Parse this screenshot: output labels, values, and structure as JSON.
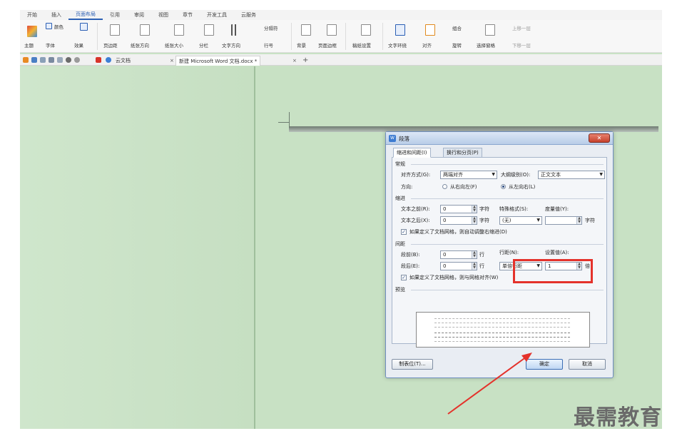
{
  "menu": {
    "tabs": [
      "开始",
      "插入",
      "页面布局",
      "引用",
      "审阅",
      "视图",
      "章节",
      "开发工具",
      "云服务"
    ],
    "active_tab": "页面布局"
  },
  "ribbon": {
    "theme": "主题",
    "color": "颜色",
    "font": "字体",
    "effect": "效果",
    "margins": "页边距",
    "orientation": "纸张方向",
    "size": "纸张大小",
    "columns": "分栏",
    "text_direction": "文字方向",
    "line_numbers": "行号",
    "separator": "分隔符",
    "background": "背景",
    "page_border": "页面边框",
    "draft_settings": "稿纸设置",
    "text_wrap": "文字环绕",
    "align": "对齐",
    "rotate": "旋转",
    "selection_pane": "选择窗格",
    "group": "组合",
    "bring_forward": "上移一层",
    "send_backward": "下移一层"
  },
  "tabbar": {
    "wps_tab": "云文档",
    "doc_tab": "新建 Microsoft Word 文档.docx *",
    "add_tab": "+"
  },
  "dialog": {
    "title": "段落",
    "tabs": [
      "缩进和间距(I)",
      "换行和分页(P)"
    ],
    "general_section": "常规",
    "align_label": "对齐方式(G):",
    "align_value": "两端对齐",
    "outline_label": "大纲级别(O):",
    "outline_value": "正文文本",
    "direction_label": "方向:",
    "rtl_label": "从右向左(F)",
    "ltr_label": "从左向右(L)",
    "indent_section": "缩进",
    "before_text_label": "文本之前(R):",
    "before_text_value": "0",
    "after_text_label": "文本之后(X):",
    "after_text_value": "0",
    "unit_char": "字符",
    "special_label": "特殊格式(S):",
    "special_value": "(无)",
    "measure_label": "度量值(Y):",
    "indent_grid_check": "如果定义了文档网格，则自动调整右缩进(D)",
    "spacing_section": "间距",
    "before_label": "段前(B):",
    "before_value": "0",
    "after_label": "段后(E):",
    "after_value": "0",
    "unit_line": "行",
    "line_spacing_label": "行距(N):",
    "line_spacing_value": "单倍行距",
    "set_value_label": "设置值(A):",
    "set_value": "1",
    "unit_times": "倍",
    "spacing_grid_check": "如果定义了文档网格，则与网格对齐(W)",
    "preview_section": "预览",
    "tabs_button": "制表位(T)...",
    "ok_button": "确定",
    "cancel_button": "取消"
  },
  "watermark": "最需教育",
  "colors": {
    "workspace": "#c8e1c4",
    "highlight": "#e4322b",
    "accent": "#2b5fb4"
  }
}
